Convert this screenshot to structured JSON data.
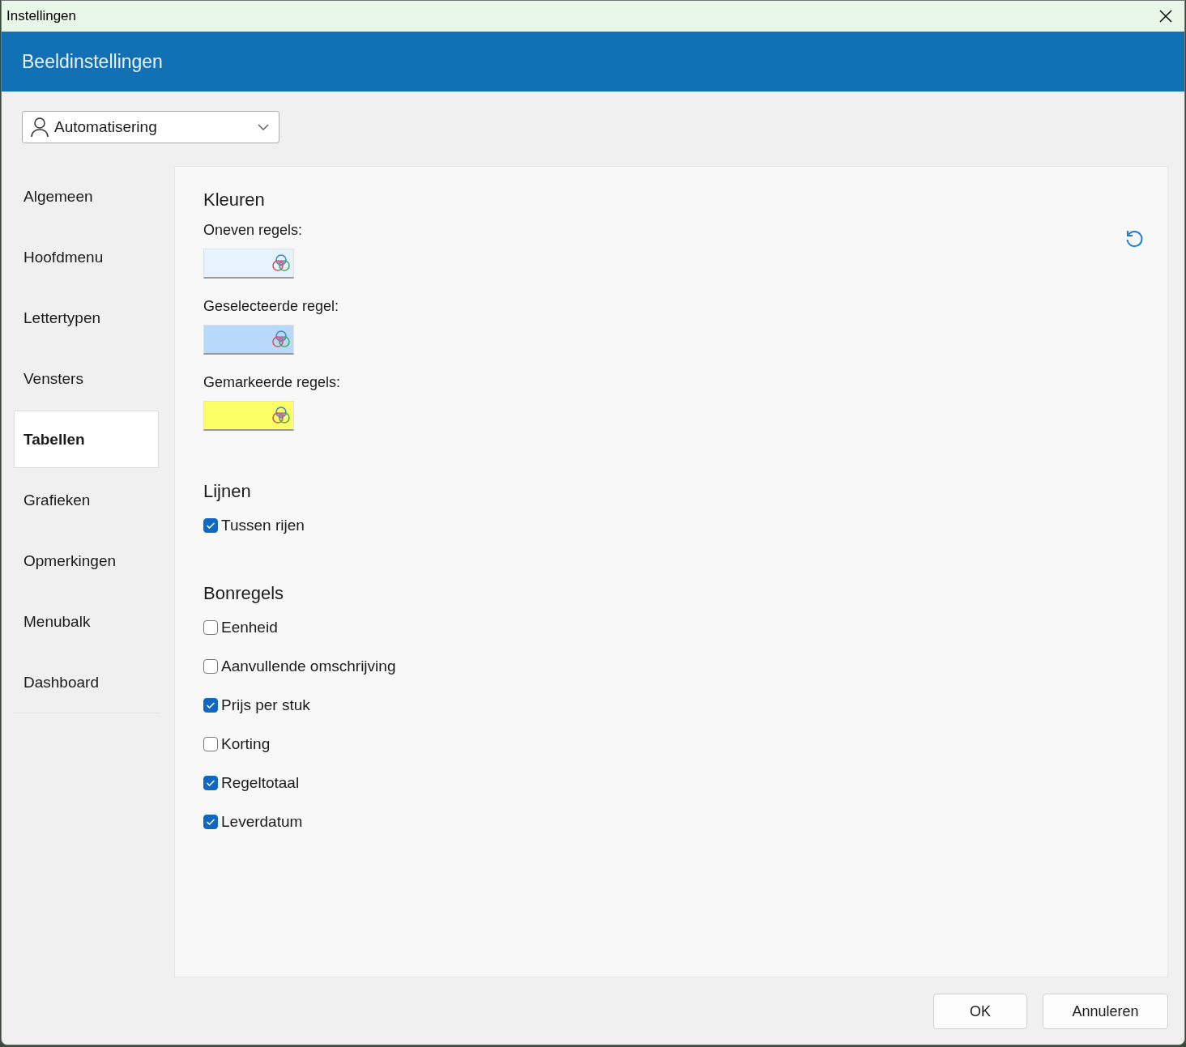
{
  "window": {
    "title": "Instellingen"
  },
  "header": {
    "title": "Beeldinstellingen"
  },
  "profile_dropdown": {
    "value": "Automatisering"
  },
  "sidebar": {
    "items": [
      {
        "label": "Algemeen",
        "selected": false
      },
      {
        "label": "Hoofdmenu",
        "selected": false
      },
      {
        "label": "Lettertypen",
        "selected": false
      },
      {
        "label": "Vensters",
        "selected": false
      },
      {
        "label": "Tabellen",
        "selected": true
      },
      {
        "label": "Grafieken",
        "selected": false
      },
      {
        "label": "Opmerkingen",
        "selected": false
      },
      {
        "label": "Menubalk",
        "selected": false
      },
      {
        "label": "Dashboard",
        "selected": false
      }
    ]
  },
  "sections": [
    {
      "heading": "Kleuren",
      "items": [
        {
          "kind": "color",
          "label": "Oneven regels:",
          "color": "#e6f2ff"
        },
        {
          "kind": "color",
          "label": "Geselecteerde regel:",
          "color": "#b9d9fb"
        },
        {
          "kind": "color",
          "label": "Gemarkeerde regels:",
          "color": "#ffff66"
        }
      ]
    },
    {
      "heading": "Lijnen",
      "items": [
        {
          "kind": "checkbox",
          "label": "Tussen rijen",
          "checked": true
        }
      ]
    },
    {
      "heading": "Bonregels",
      "items": [
        {
          "kind": "checkbox",
          "label": "Eenheid",
          "checked": false
        },
        {
          "kind": "checkbox",
          "label": "Aanvullende omschrijving",
          "checked": false
        },
        {
          "kind": "checkbox",
          "label": "Prijs per stuk",
          "checked": true
        },
        {
          "kind": "checkbox",
          "label": "Korting",
          "checked": false
        },
        {
          "kind": "checkbox",
          "label": "Regeltotaal",
          "checked": true
        },
        {
          "kind": "checkbox",
          "label": "Leverdatum",
          "checked": true
        }
      ]
    }
  ],
  "buttons": [
    "OK",
    "Annuleren"
  ]
}
